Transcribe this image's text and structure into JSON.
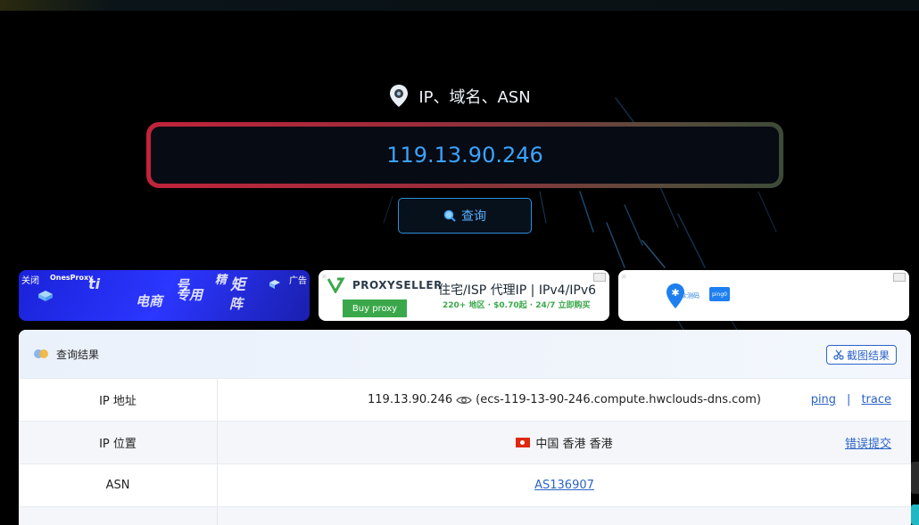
{
  "header": {
    "title": "IP、域名、ASN",
    "icon": "location-pin-icon"
  },
  "search": {
    "value": "119.13.90.246",
    "button_label": "查询"
  },
  "ads": {
    "ad1": {
      "close": "关闭",
      "label": "广告",
      "brand": "OnesProxy",
      "words": [
        "号",
        "精",
        "矩",
        "电商",
        "专用",
        "阵",
        "ti"
      ]
    },
    "ad2": {
      "brand": "PROXYSELLER",
      "button": "Buy proxy",
      "headline": "住宅/ISP 代理IP | IPv4/IPv6",
      "sub": "220+ 地区 · $0.70起 · 24/7 立即购买"
    },
    "ad3": {
      "pin_label": "众测码",
      "button": "ping0"
    }
  },
  "result": {
    "title": "查询结果",
    "screenshot_button": "截图结果",
    "rows": [
      {
        "key": "IP 地址",
        "ip": "119.13.90.246",
        "host": "(ecs-119-13-90-246.compute.hwclouds-dns.com)",
        "links": [
          "ping",
          "trace"
        ],
        "separator": "|"
      },
      {
        "key": "IP 位置",
        "location": "中国 香港 香港",
        "link": "错误提交"
      },
      {
        "key": "ASN",
        "value": "AS136907"
      },
      {
        "key": ""
      }
    ]
  },
  "colors": {
    "accent": "#2b63c9",
    "search_text": "#3ba3ff",
    "border_left": "#c0243a",
    "border_right": "#3d4a38"
  }
}
